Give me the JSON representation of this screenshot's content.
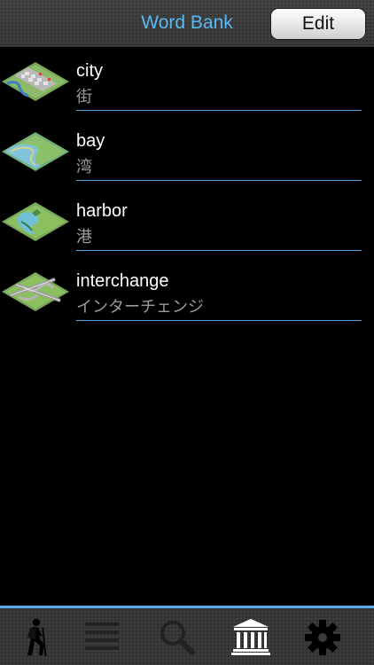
{
  "header": {
    "title": "Word Bank",
    "edit_label": "Edit"
  },
  "colors": {
    "accent": "#5ab8f0",
    "divider": "#4aa3e0",
    "background": "#000000",
    "bar": "#3a3a3a"
  },
  "words": [
    {
      "word": "city",
      "reading": "街",
      "icon": "city-map-icon"
    },
    {
      "word": "bay",
      "reading": "湾",
      "icon": "bay-map-icon"
    },
    {
      "word": "harbor",
      "reading": "港",
      "icon": "harbor-map-icon"
    },
    {
      "word": "interchange",
      "reading": "インターチェンジ",
      "icon": "interchange-map-icon"
    }
  ],
  "tabbar": {
    "tabs": [
      {
        "icon": "hiker-icon"
      },
      {
        "icon": "list-icon"
      },
      {
        "icon": "search-icon"
      },
      {
        "icon": "bank-icon",
        "selected": true
      },
      {
        "icon": "gear-icon"
      }
    ]
  }
}
